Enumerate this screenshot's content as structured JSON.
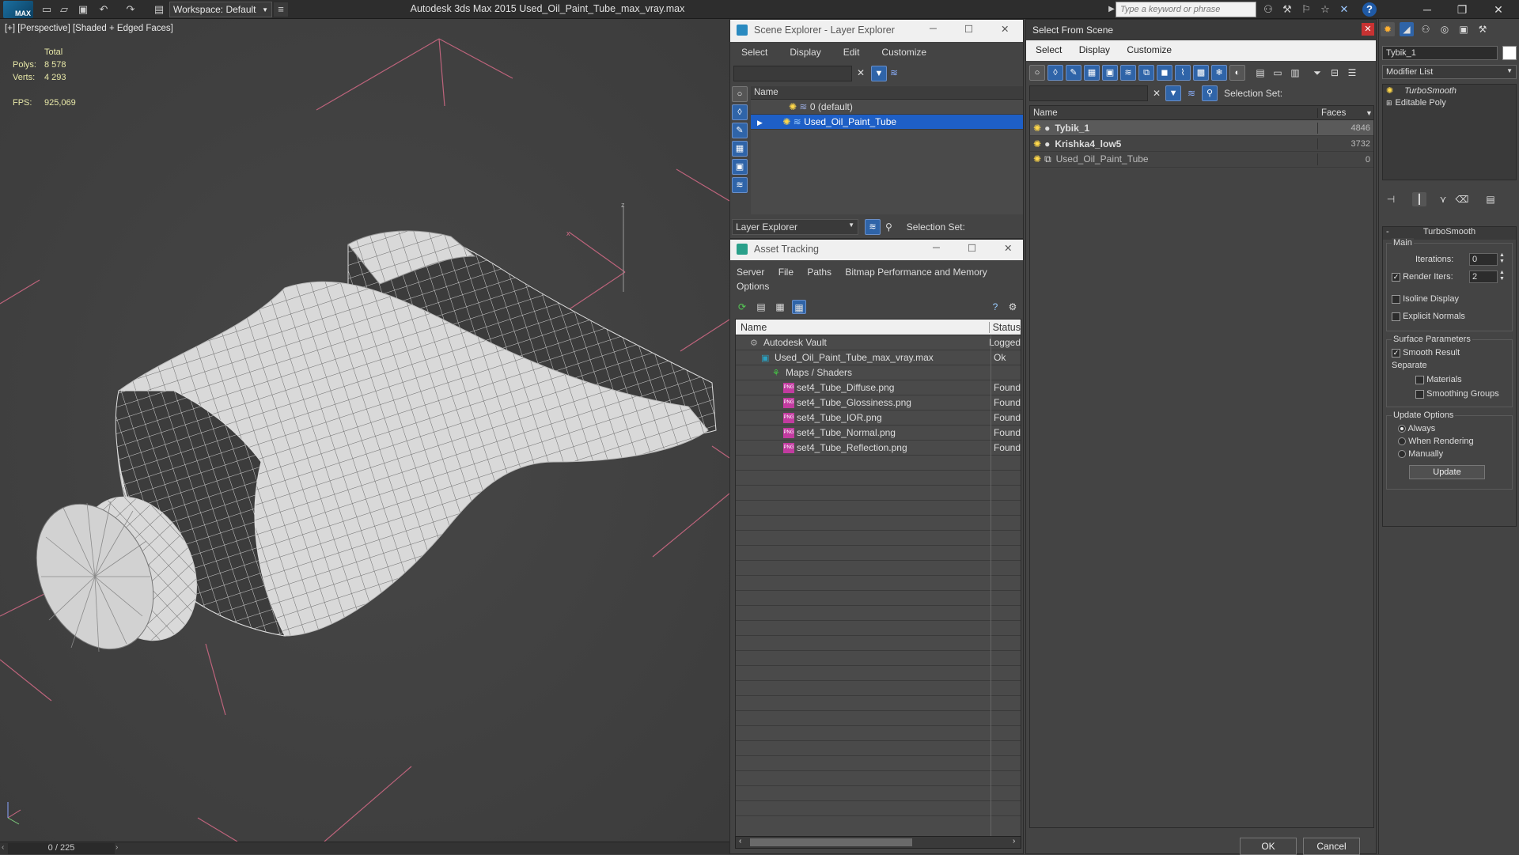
{
  "titlebar": {
    "logo": "MAX",
    "workspace": "Workspace: Default",
    "title": "Autodesk 3ds Max  2015      Used_Oil_Paint_Tube_max_vray.max",
    "search_placeholder": "Type a keyword or phrase"
  },
  "viewport": {
    "label": "[+] [Perspective] [Shaded + Edged Faces]",
    "total_label": "Total",
    "polys_label": "Polys:",
    "polys_value": "8 578",
    "verts_label": "Verts:",
    "verts_value": "4 293",
    "fps_label": "FPS:",
    "fps_value": "925,069",
    "axis_z": "z",
    "axis_x": "x"
  },
  "timeline": {
    "frame": "0 / 225"
  },
  "scene_explorer": {
    "title": "Scene Explorer - Layer Explorer",
    "menu": [
      "Select",
      "Display",
      "Edit",
      "Customize"
    ],
    "column_name": "Name",
    "rows": [
      "0 (default)",
      "Used_Oil_Paint_Tube"
    ],
    "explorer_select": "Layer Explorer",
    "selection_set": "Selection Set:"
  },
  "asset_tracking": {
    "title": "Asset Tracking",
    "menu": [
      "Server",
      "File",
      "Paths",
      "Bitmap Performance and Memory"
    ],
    "menu2": "Options",
    "col_name": "Name",
    "col_status": "Status",
    "rows": [
      {
        "name": "Autodesk Vault",
        "status": "Logged",
        "indent": 0,
        "icon": "vault"
      },
      {
        "name": "Used_Oil_Paint_Tube_max_vray.max",
        "status": "Ok",
        "indent": 1,
        "icon": "max"
      },
      {
        "name": "Maps / Shaders",
        "status": "",
        "indent": 2,
        "icon": "maps"
      },
      {
        "name": "set4_Tube_Diffuse.png",
        "status": "Found",
        "indent": 3,
        "icon": "png"
      },
      {
        "name": "set4_Tube_Glossiness.png",
        "status": "Found",
        "indent": 3,
        "icon": "png"
      },
      {
        "name": "set4_Tube_IOR.png",
        "status": "Found",
        "indent": 3,
        "icon": "png"
      },
      {
        "name": "set4_Tube_Normal.png",
        "status": "Found",
        "indent": 3,
        "icon": "png"
      },
      {
        "name": "set4_Tube_Reflection.png",
        "status": "Found",
        "indent": 3,
        "icon": "png"
      }
    ],
    "png_badge": "PNG"
  },
  "select_from_scene": {
    "title": "Select From Scene",
    "menu": [
      "Select",
      "Display",
      "Customize"
    ],
    "selection_set": "Selection Set:",
    "col_name": "Name",
    "col_faces": "Faces",
    "rows": [
      {
        "name": "Tybik_1",
        "faces": "4846"
      },
      {
        "name": "Krishka4_low5",
        "faces": "3732"
      },
      {
        "name": "Used_Oil_Paint_Tube",
        "faces": "0"
      }
    ],
    "ok": "OK",
    "cancel": "Cancel"
  },
  "command_panel": {
    "object_name": "Tybik_1",
    "modifier_list": "Modifier List",
    "stack": [
      "TurboSmooth",
      "Editable Poly"
    ],
    "rollout_title": "TurboSmooth",
    "main_label": "Main",
    "iterations_label": "Iterations:",
    "iterations_value": "0",
    "render_iters_label": "Render Iters:",
    "render_iters_value": "2",
    "isoline": "Isoline Display",
    "explicit_normals": "Explicit Normals",
    "surface_params": "Surface Parameters",
    "smooth_result": "Smooth Result",
    "separate": "Separate",
    "materials": "Materials",
    "smoothing_groups": "Smoothing Groups",
    "update_options": "Update Options",
    "always": "Always",
    "when_rendering": "When Rendering",
    "manually": "Manually",
    "update_btn": "Update"
  },
  "colors": {
    "selection": "#1e5fc6",
    "accent_red": "#c83232",
    "grid": "#d36a86"
  }
}
